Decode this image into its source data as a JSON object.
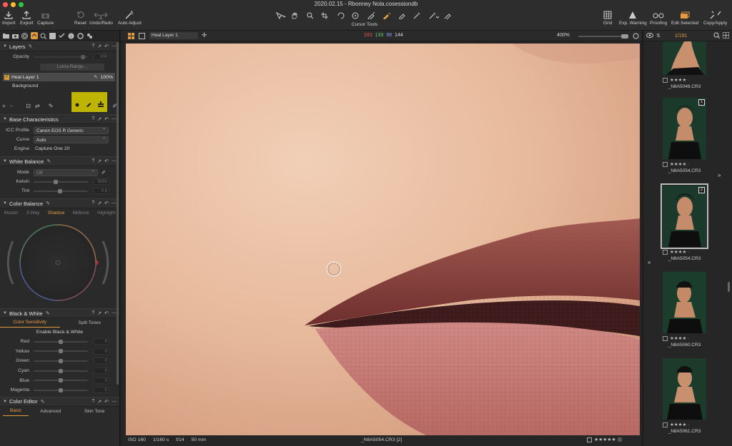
{
  "window": {
    "title": "2020.02.15 - Rbonney Nola.cosessiondb"
  },
  "toolbar": {
    "import": "Import",
    "export": "Export",
    "capture": "Capture",
    "reset": "Reset",
    "undo_redo": "Undo/Redo",
    "auto_adjust": "Auto Adjust",
    "cursor_tools": "Cursor Tools",
    "grid": "Grid",
    "exp_warning": "Exp. Warning",
    "proofing": "Proofing",
    "edit_selected": "Edit Selected",
    "copy_apply": "Copy/Apply"
  },
  "layers": {
    "title": "Layers",
    "opacity_label": "Opacity",
    "opacity_value": "100",
    "luma_range": "Luma Range...",
    "items": [
      {
        "name": "Heal Layer 1",
        "opacity": "100%"
      },
      {
        "name": "Background"
      }
    ]
  },
  "base": {
    "title": "Base Characteristics",
    "icc_label": "ICC Profile",
    "icc_value": "Canon EOS R Generic",
    "curve_label": "Curve",
    "curve_value": "Auto",
    "engine_label": "Engine",
    "engine_value": "Capture One 20"
  },
  "wb": {
    "title": "White Balance",
    "mode_label": "Mode",
    "mode_value": "Off",
    "kelvin_label": "Kelvin",
    "kelvin_value": "5093",
    "tint_label": "Tint",
    "tint_value": "0.8"
  },
  "color_balance": {
    "title": "Color Balance",
    "tabs": [
      "Master",
      "3-Way",
      "Shadow",
      "Midtone",
      "Highlight"
    ],
    "active_tab": "Shadow"
  },
  "bw": {
    "title": "Black & White",
    "tab1": "Color Sensitivity",
    "tab2": "Split Tones",
    "enable": "Enable Black & White",
    "channels": [
      {
        "label": "Red",
        "value": "0"
      },
      {
        "label": "Yellow",
        "value": "0"
      },
      {
        "label": "Green",
        "value": "0"
      },
      {
        "label": "Cyan",
        "value": "0"
      },
      {
        "label": "Blue",
        "value": "0"
      },
      {
        "label": "Magenta",
        "value": "0"
      }
    ]
  },
  "color_editor": {
    "title": "Color Editor",
    "tabs": [
      "Basic",
      "Advanced",
      "Skin Tone"
    ]
  },
  "viewer": {
    "layer_select": "Heal Layer 1",
    "r": "183",
    "g": "133",
    "b": "98",
    "l": "144",
    "zoom": "400%"
  },
  "status": {
    "iso": "ISO 160",
    "shutter": "1/160 s",
    "aperture": "f/14",
    "focal": "50 mm",
    "filename": "_N8A5054.CR3 [2]"
  },
  "browser": {
    "count": "1/191",
    "thumbs": [
      {
        "file": "_N8A5048.CR3",
        "badge": ""
      },
      {
        "file": "_N8A5054.CR3",
        "badge": "1"
      },
      {
        "file": "_N8A5054.CR3",
        "badge": "2"
      },
      {
        "file": "_N8A5060.CR3",
        "badge": ""
      },
      {
        "file": "_N8A5061.CR3",
        "badge": ""
      }
    ]
  },
  "colors": {
    "accent": "#e39b3f",
    "highlight": "#cfc200"
  }
}
